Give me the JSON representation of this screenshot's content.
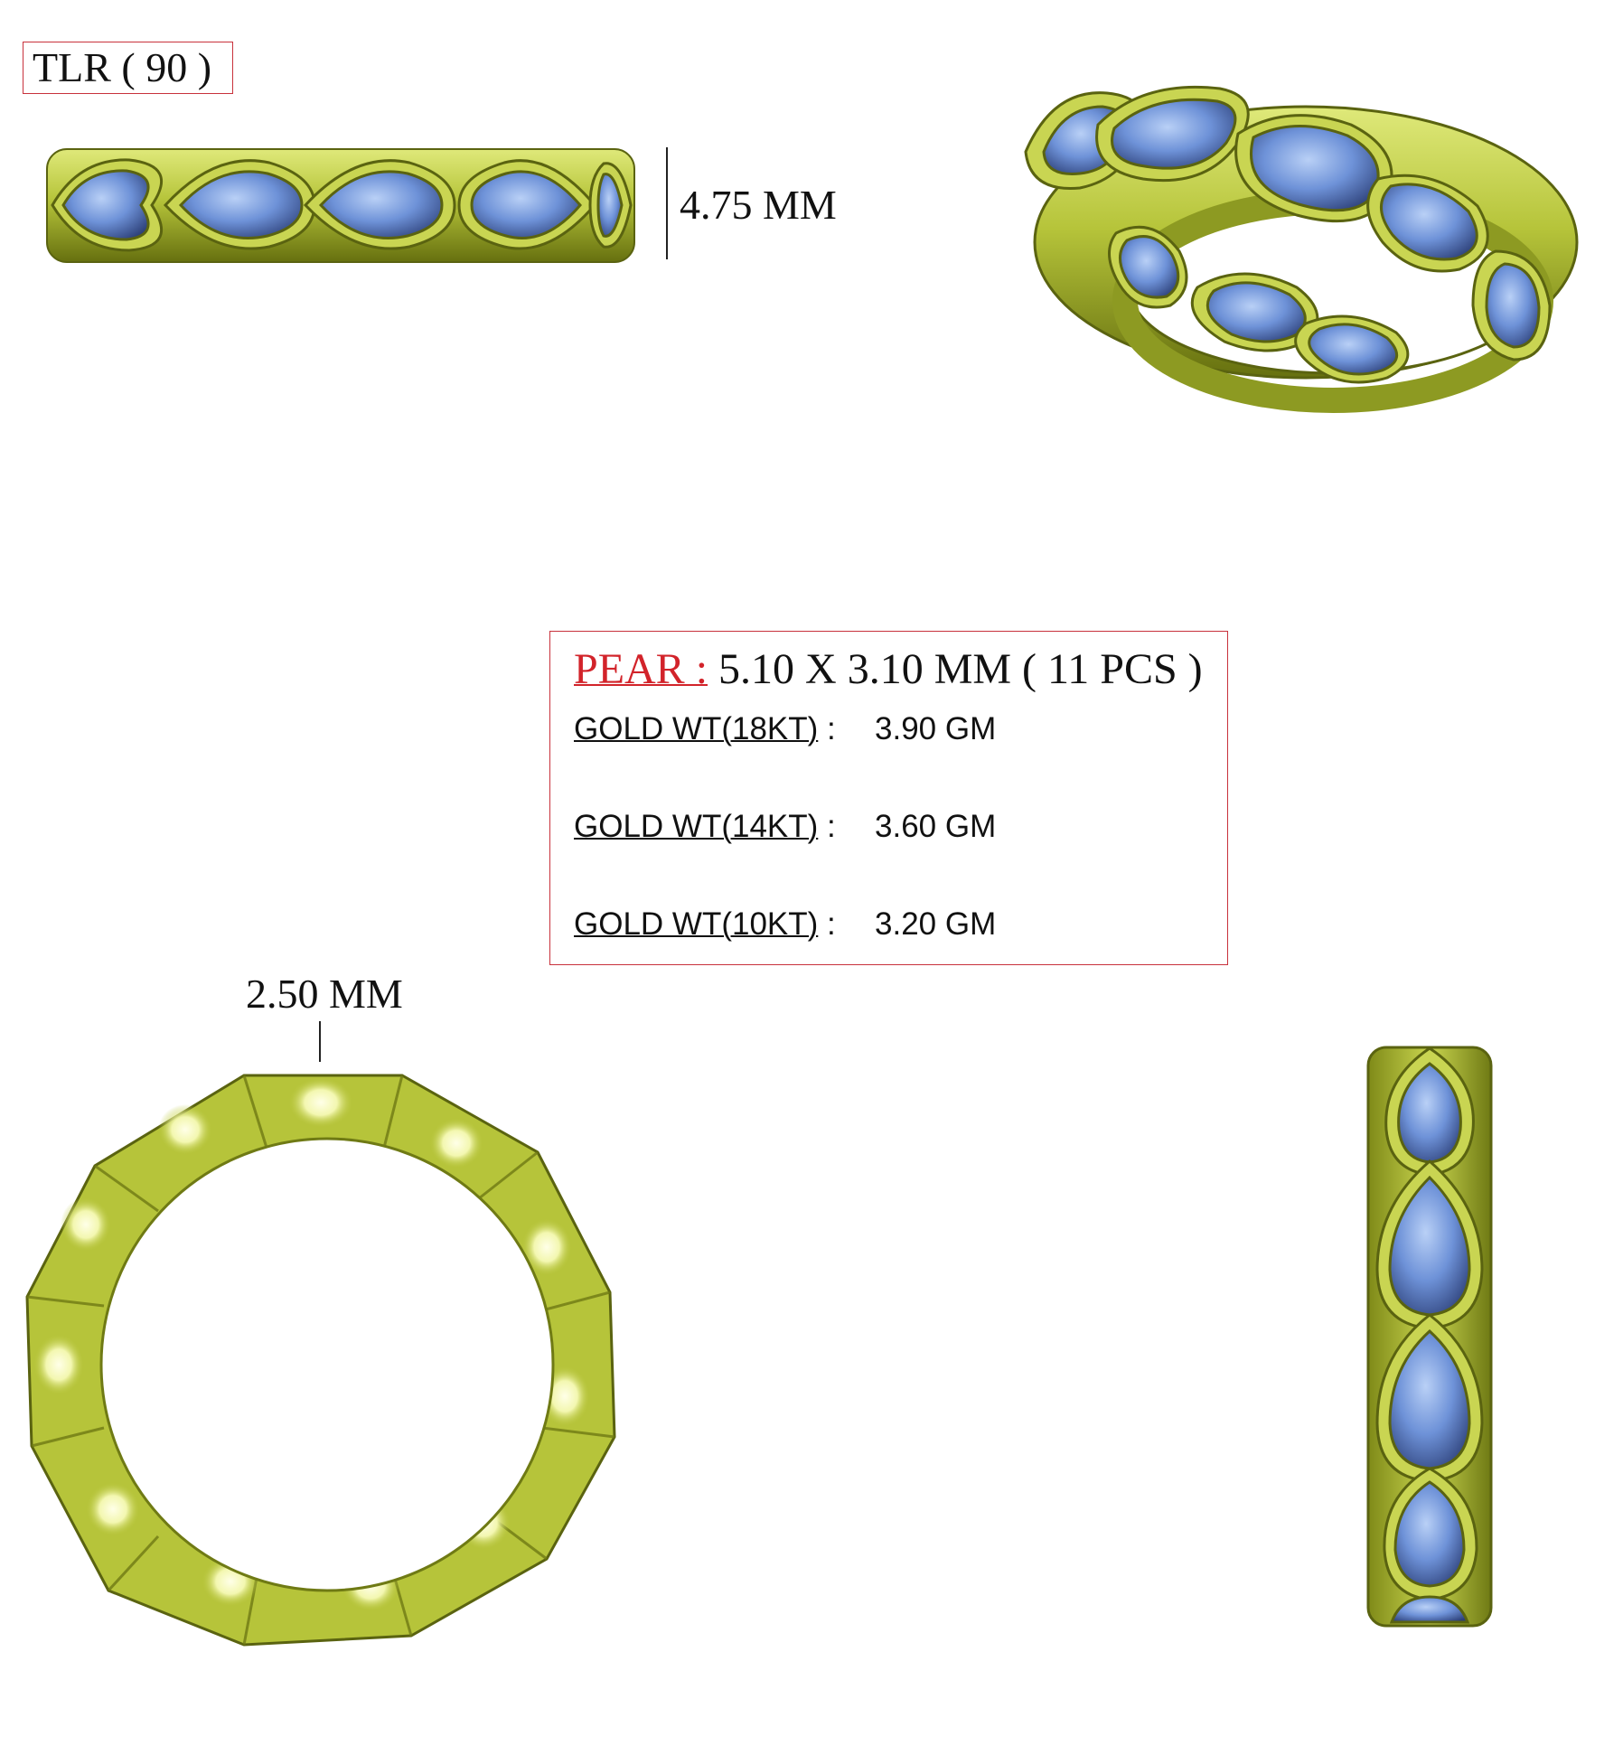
{
  "design_code": "TLR ( 90 )",
  "dimensions": {
    "height": "4.75 MM",
    "width": "2.50 MM"
  },
  "stone": {
    "label": "PEAR :",
    "detail": "5.10 X 3.10 MM ( 11 PCS )"
  },
  "gold_weights": [
    {
      "label": "GOLD WT(18KT)",
      "sep": ":",
      "value": "3.90 GM"
    },
    {
      "label": "GOLD WT(14KT)",
      "sep": ":",
      "value": "3.60 GM"
    },
    {
      "label": "GOLD WT(10KT)",
      "sep": ":",
      "value": "3.20 GM"
    }
  ],
  "colors": {
    "gold": "#b6c43a",
    "gold_dark": "#6f7a14",
    "gold_light": "#eef4a0",
    "gem": "#6e92d8",
    "gem_dark": "#2c3f77",
    "box_border": "#c8323c",
    "label_red": "#d2232a"
  }
}
